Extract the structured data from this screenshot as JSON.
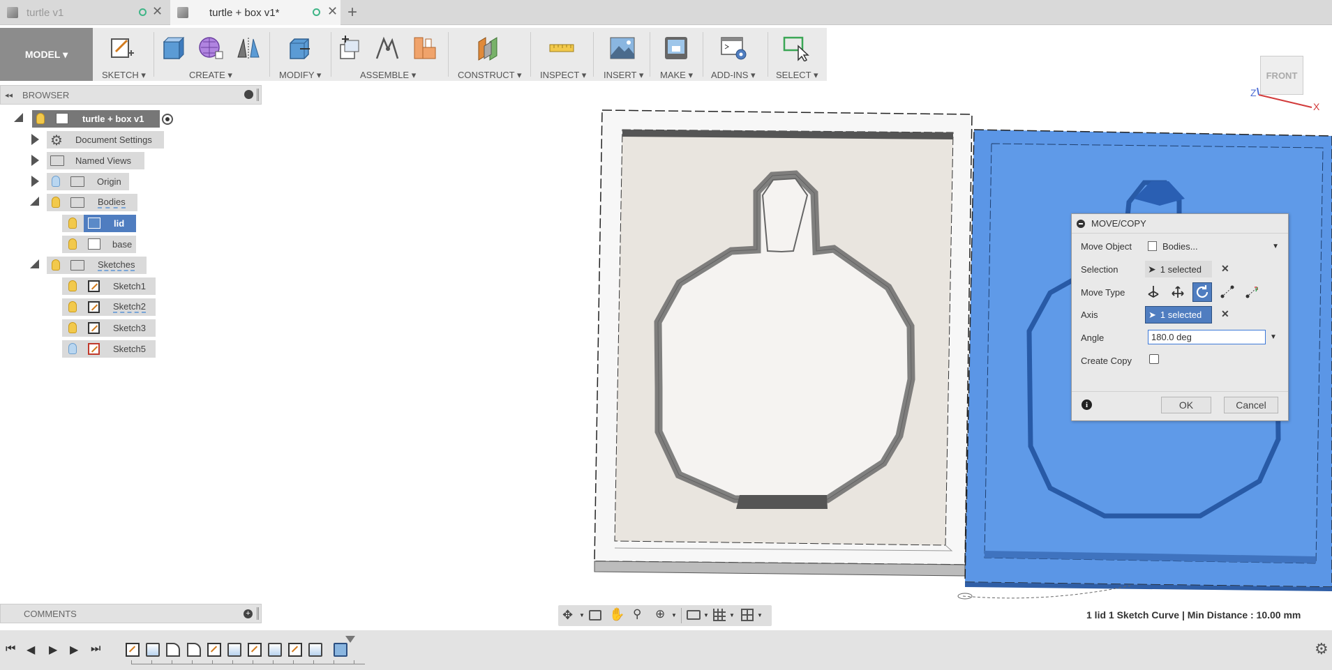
{
  "tabs": [
    {
      "title": "turtle v1",
      "active": false
    },
    {
      "title": "turtle + box v1*",
      "active": true
    }
  ],
  "new_tab_label": "+",
  "toolbar": {
    "workspace": "MODEL ▾",
    "groups": [
      "SKETCH ▾",
      "CREATE ▾",
      "MODIFY ▾",
      "ASSEMBLE ▾",
      "CONSTRUCT ▾",
      "INSPECT ▾",
      "INSERT ▾",
      "MAKE ▾",
      "ADD-INS ▾",
      "SELECT ▾"
    ]
  },
  "browser": {
    "title": "BROWSER",
    "root": "turtle + box v1",
    "items": [
      "Document Settings",
      "Named Views",
      "Origin",
      "Bodies",
      "lid",
      "base",
      "Sketches",
      "Sketch1",
      "Sketch2",
      "Sketch3",
      "Sketch5"
    ]
  },
  "comments_label": "COMMENTS",
  "viewcube_label": "FRONT",
  "axis_labels": {
    "z": "Z",
    "x": "X"
  },
  "dialog": {
    "title": "MOVE/COPY",
    "move_object_label": "Move Object",
    "move_object_value": "Bodies...",
    "selection_label": "Selection",
    "selection_value": "1 selected",
    "move_type_label": "Move Type",
    "axis_label": "Axis",
    "axis_value": "1 selected",
    "angle_label": "Angle",
    "angle_value": "180.0 deg",
    "create_copy_label": "Create Copy",
    "ok_label": "OK",
    "cancel_label": "Cancel",
    "clear_glyph": "✕",
    "info_glyph": "i"
  },
  "status_text": "1 lid 1 Sketch Curve | Min Distance : 10.00 mm",
  "colors": {
    "selection_blue": "#5b96e6",
    "highlight": "#4f7dc0",
    "toolbar_bg": "#eaeaea"
  }
}
